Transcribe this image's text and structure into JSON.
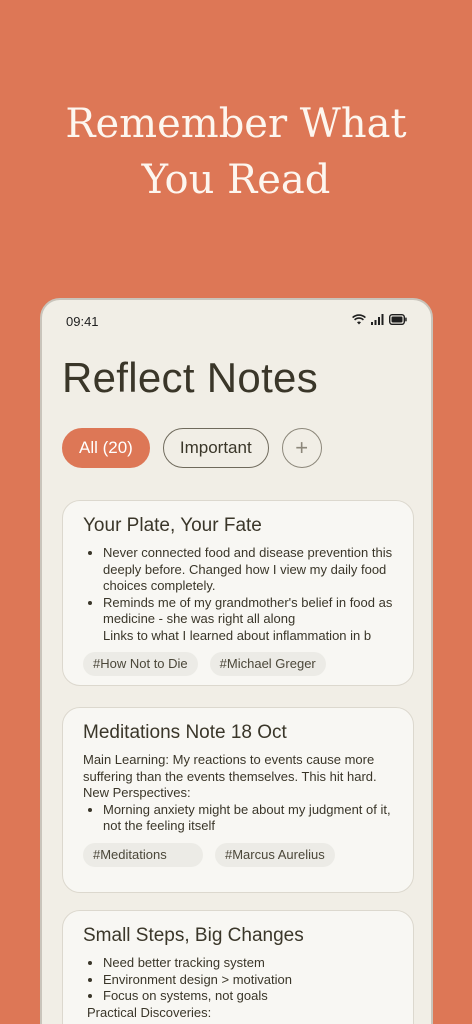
{
  "headline": {
    "line1": "Remember What",
    "line2": "You Read"
  },
  "status_bar": {
    "time": "09:41"
  },
  "app": {
    "title": "Reflect Notes"
  },
  "filters": {
    "all": "All (20)",
    "important": "Important",
    "add": "+"
  },
  "cards": [
    {
      "title": "Your Plate, Your Fate",
      "bullets": [
        "Never connected food and disease prevention this deeply before. Changed how I view my daily food choices completely.",
        "Reminds me of my grandmother's belief in food as medicine - she was right all along",
        "Links to what I learned about inflammation in b"
      ],
      "tags": [
        "#How Not to Die",
        "#Michael Greger"
      ]
    },
    {
      "title": "Meditations Note 18 Oct",
      "text1": "Main Learning: My reactions to events cause more suffering than the events themselves. This hit hard.",
      "text2": "New Perspectives:",
      "bullets": [
        "Morning anxiety might be about my judgment of it, not the feeling itself"
      ],
      "tags": [
        "#Meditations",
        "#Marcus Aurelius"
      ]
    },
    {
      "title": "Small Steps, Big Changes",
      "bullets": [
        "Need better tracking system",
        "Environment design > motivation",
        "Focus on systems, not goals"
      ],
      "text1": "Practical Discoveries:"
    }
  ]
}
